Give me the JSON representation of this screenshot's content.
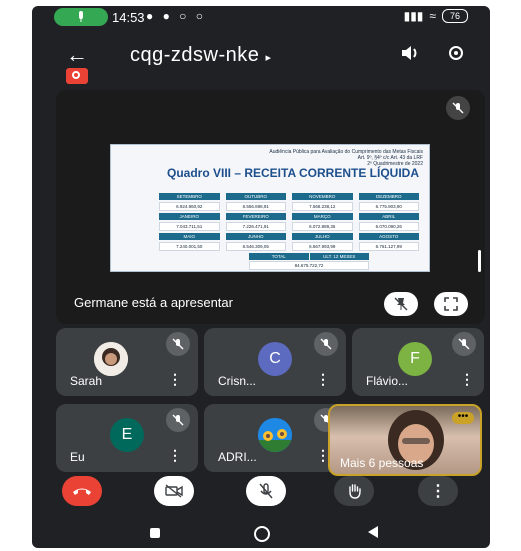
{
  "status_bar": {
    "time": "14:53",
    "battery": "76"
  },
  "top_bar": {
    "meeting_code": "cqg-zdsw-nke"
  },
  "presentation": {
    "slide": {
      "header_line1": "Audiência Pública para Avaliação do Cumprimento das Metas Fiscais",
      "header_line2": "Art. 9º, §4º c/c Art. 43 da LRF",
      "header_line3": "2º Quadrimestre de 2022",
      "title": "Quadro VIII – RECEITA CORRENTE LÍQUIDA",
      "months": [
        {
          "label": "SETEMBRO",
          "value": "6.924.960,92"
        },
        {
          "label": "OUTUBRO",
          "value": "6.556.698,91"
        },
        {
          "label": "NOVEMBRO",
          "value": "7.568.238,12"
        },
        {
          "label": "DEZEMBRO",
          "value": "6.775.903,90"
        },
        {
          "label": "JANEIRO",
          "value": "7.043.711,51"
        },
        {
          "label": "FEVEREIRO",
          "value": "7.226.471,91"
        },
        {
          "label": "MARÇO",
          "value": "6.072.889,36"
        },
        {
          "label": "ABRIL",
          "value": "6.070.090,26"
        },
        {
          "label": "MAIO",
          "value": "7.240.001,50"
        },
        {
          "label": "JUNHO",
          "value": "6.546.309,05"
        },
        {
          "label": "JULHO",
          "value": "6.567.993,99"
        },
        {
          "label": "AGOSTO",
          "value": "6.761.127,99"
        }
      ],
      "total_label": "TOTAL",
      "last12_label": "ULT. 12 MESES",
      "total_value": "84.675.722,72"
    },
    "presenter_label": "Germane está a apresentar"
  },
  "participants": [
    {
      "name": "Sarah",
      "avatar": "photo",
      "color": "#ffffff"
    },
    {
      "name": "Crisn...",
      "avatar": "C",
      "color": "#5c6bc0"
    },
    {
      "name": "Flávio...",
      "avatar": "F",
      "color": "#7cb342"
    },
    {
      "name": "Eu",
      "avatar": "E",
      "color": "#00695c"
    },
    {
      "name": "ADRI...",
      "avatar": "sunflower-photo",
      "color": "#1976d2"
    }
  ],
  "more_people_label": "Mais 6 pessoas",
  "controls": {
    "end_call_color": "#ea4335",
    "items": [
      "end-call",
      "camera-off",
      "mic-off",
      "raise-hand",
      "more-options"
    ]
  }
}
